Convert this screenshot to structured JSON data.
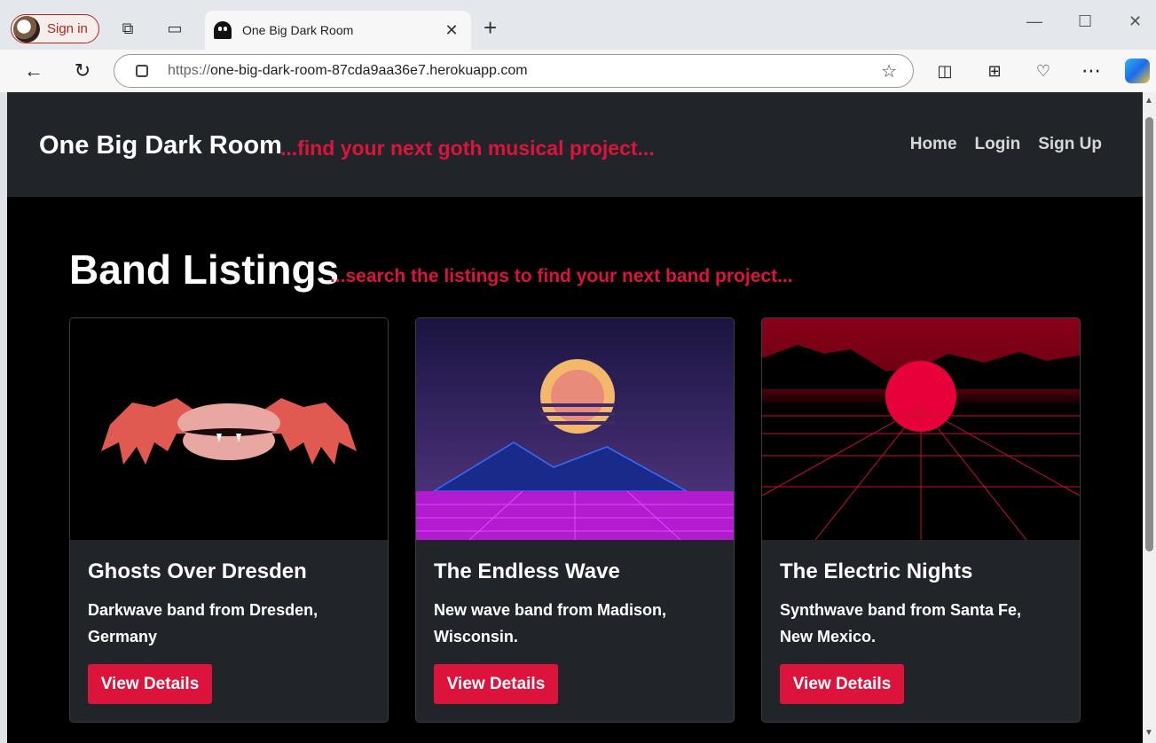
{
  "browser": {
    "signin_label": "Sign in",
    "tab_title": "One Big Dark Room",
    "url_prefix": "https://",
    "url_host": "one-big-dark-room-87cda9aa36e7.herokuapp.com"
  },
  "site": {
    "brand": "One Big Dark Room",
    "tagline": "...find your next goth musical project...",
    "nav": [
      "Home",
      "Login",
      "Sign Up"
    ]
  },
  "main": {
    "heading": "Band Listings",
    "subheading": "...search the listings to find your next band project...",
    "cards": [
      {
        "name": "Ghosts Over Dresden",
        "desc": "Darkwave band from Dresden, Germany",
        "button": "View Details"
      },
      {
        "name": "The Endless Wave",
        "desc": "New wave band from Madison, Wisconsin.",
        "button": "View Details"
      },
      {
        "name": "The Electric Nights",
        "desc": "Synthwave band from Santa Fe, New Mexico.",
        "button": "View Details"
      }
    ]
  },
  "colors": {
    "accent": "#dc143c",
    "navbar": "#212529",
    "page_bg": "#000000"
  }
}
